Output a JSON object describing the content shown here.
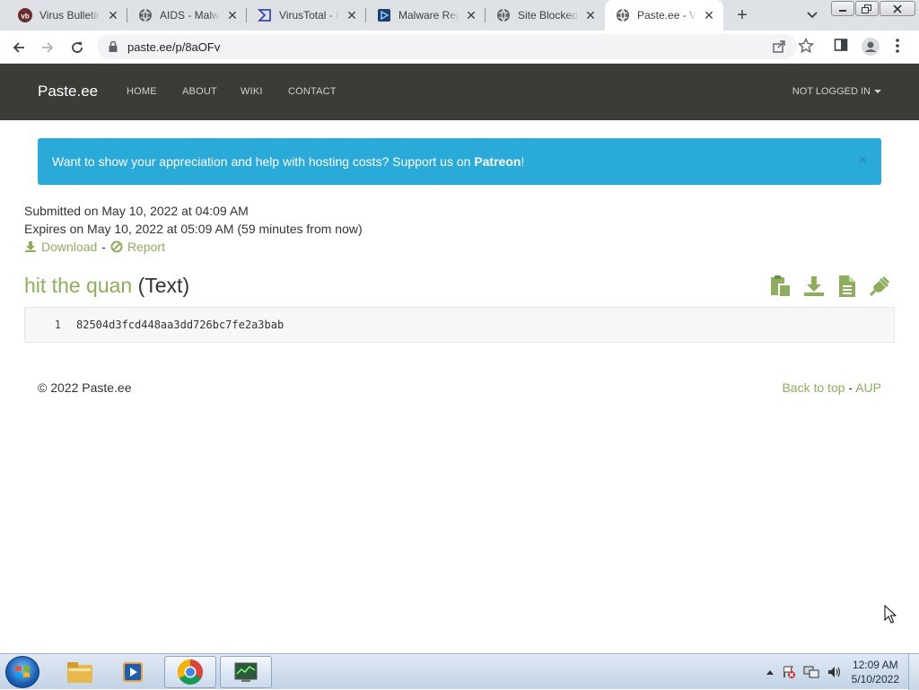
{
  "browser": {
    "tabs": [
      {
        "title": "Virus Bulletin",
        "icon": "vb-icon",
        "active": false
      },
      {
        "title": "AIDS - Malware",
        "icon": "globe-icon",
        "active": false
      },
      {
        "title": "VirusTotal - File",
        "icon": "virustotal-icon",
        "active": false
      },
      {
        "title": "Malware Report",
        "icon": "malware-report-icon",
        "active": false
      },
      {
        "title": "Site Blocked",
        "icon": "globe-icon",
        "active": false
      },
      {
        "title": "Paste.ee - View",
        "icon": "globe-icon",
        "active": true
      }
    ],
    "url": "paste.ee/p/8aOFv"
  },
  "site": {
    "brand": "Paste.ee",
    "nav": [
      "HOME",
      "ABOUT",
      "WIKI",
      "CONTACT"
    ],
    "login": "NOT LOGGED IN"
  },
  "alert": {
    "text": "Want to show your appreciation and help with hosting costs? Support us on ",
    "link": "Patreon",
    "suffix": "!",
    "close": "×"
  },
  "paste": {
    "submitted": "Submitted on May 10, 2022 at 04:09 AM",
    "expires": "Expires on May 10, 2022 at 05:09 AM (59 minutes from now)",
    "download": "Download",
    "report": "Report",
    "link_sep": "-",
    "title": "hit the quan",
    "type": "(Text)",
    "lines": [
      {
        "num": "1",
        "text": "82504d3fcd448aa3dd726bc7fe2a3bab"
      }
    ]
  },
  "footer": {
    "copyright": "© 2022 Paste.ee",
    "back_to_top": "Back to top",
    "sep": "-",
    "aup": "AUP"
  },
  "taskbar": {
    "time": "12:09 AM",
    "date": "5/10/2022"
  },
  "colors": {
    "accent_green": "#8dae5c",
    "nav_bg": "#3b3b37",
    "alert_bg": "#2aaad9"
  }
}
